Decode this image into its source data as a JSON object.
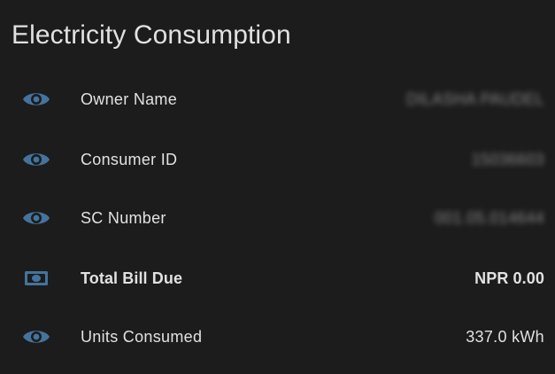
{
  "card": {
    "title": "Electricity Consumption"
  },
  "rows": [
    {
      "label": "Owner Name",
      "value": "DILASHA PAUDEL",
      "icon": "eye-icon",
      "redacted": true
    },
    {
      "label": "Consumer ID",
      "value": "15036603",
      "icon": "eye-icon",
      "redacted": true
    },
    {
      "label": "SC Number",
      "value": "001.05.014644",
      "icon": "eye-icon",
      "redacted": true
    },
    {
      "label": "Total Bill Due",
      "value": "NPR 0.00",
      "icon": "cash-icon",
      "redacted": false
    },
    {
      "label": "Units Consumed",
      "value": "337.0 kWh",
      "icon": "eye-icon",
      "redacted": false
    }
  ],
  "colors": {
    "background": "#1c1c1c",
    "text": "#e1e1e1",
    "icon": "#44739e"
  }
}
